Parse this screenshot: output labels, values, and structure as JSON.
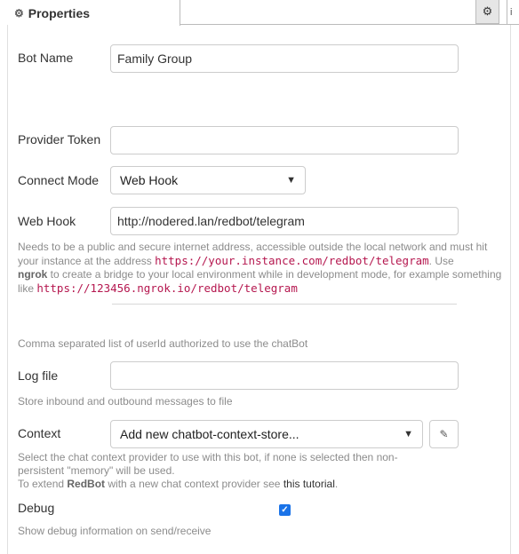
{
  "tabs": {
    "properties_label": "Properties",
    "gear_icon": "gear-icon"
  },
  "form": {
    "bot_name": {
      "label": "Bot Name",
      "value": "Family Group"
    },
    "provider_token": {
      "label": "Provider Token",
      "value": ""
    },
    "connect_mode": {
      "label": "Connect Mode",
      "selected": "Web Hook"
    },
    "web_hook": {
      "label": "Web Hook",
      "value": "http://nodered.lan/redbot/telegram",
      "help": {
        "line1": "Needs to be a public and secure internet address, accessible outside the local network and must hit",
        "line2_pre": "your instance at the address ",
        "line2_code": "https://your.instance.com/redbot/telegram",
        "line2_post": ". Use",
        "line3_bold": "ngrok",
        "line3_rest": " to create a bridge to your local environment while in development mode, for example something",
        "line4_pre": "like ",
        "line4_code": "https://123456.ngrok.io/redbot/telegram"
      }
    },
    "authorized_help": "Comma separated list of userId authorized to use the chatBot",
    "log_file": {
      "label": "Log file",
      "value": "",
      "help": "Store inbound and outbound messages to file"
    },
    "context": {
      "label": "Context",
      "selected": "Add new chatbot-context-store...",
      "help_line1": "Select the chat context provider to use with this bot, if none is selected then non-",
      "help_line2": "persistent \"memory\" will be used.",
      "help_line3_pre": "To extend ",
      "help_line3_bold": "RedBot",
      "help_line3_mid": " with a new chat context provider see ",
      "help_line3_link": "this tutorial",
      "help_line3_post": "."
    },
    "debug": {
      "label": "Debug",
      "checked": true,
      "help": "Show debug information on send/receive"
    }
  },
  "colors": {
    "accent": "#1a73e8",
    "code": "#b5174f",
    "help_text": "#8c8c8c"
  }
}
